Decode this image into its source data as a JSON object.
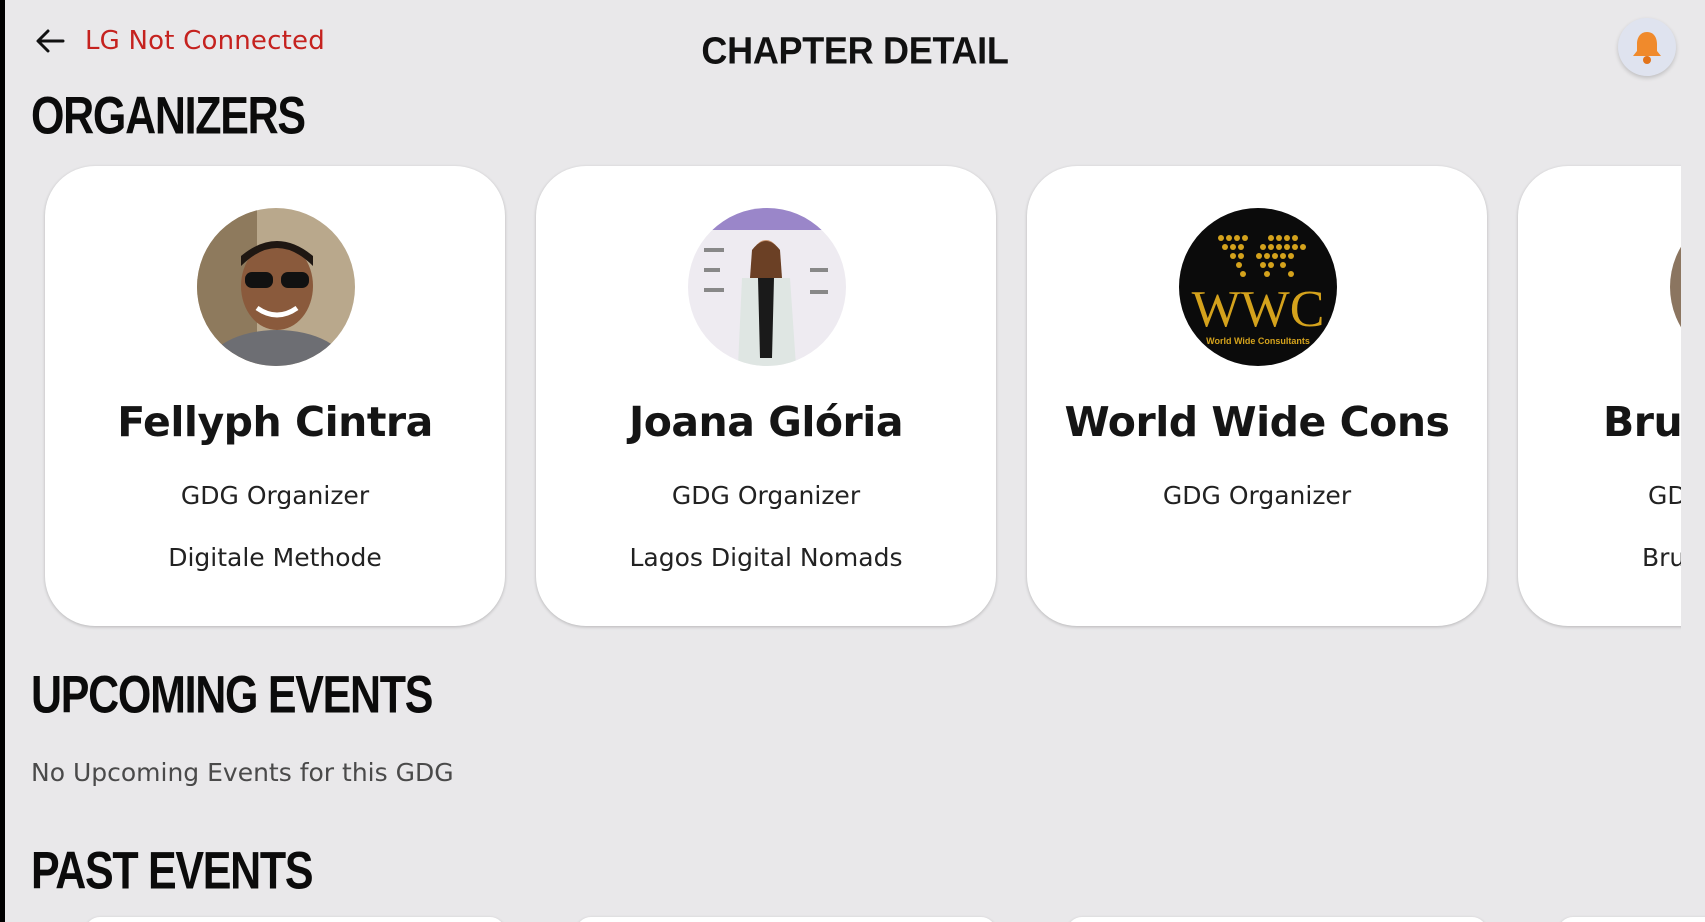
{
  "header": {
    "connection_status": "LG Not Connected",
    "title": "CHAPTER DETAIL",
    "status_color": "#c5221f",
    "back_icon": "arrow-left-icon",
    "notification_icon": "bell-icon"
  },
  "organizers": {
    "heading": "ORGANIZERS",
    "items": [
      {
        "name": "Fellyph Cintra",
        "role": "GDG Organizer",
        "company": "Digitale Methode",
        "avatar": "person-photo"
      },
      {
        "name": "Joana Glória",
        "role": "GDG Organizer",
        "company": "Lagos Digital Nomads",
        "avatar": "person-photo"
      },
      {
        "name": "World Wide Cons",
        "role": "GDG Organizer",
        "company": "",
        "avatar": "wwc-logo",
        "logo_text": "WWC",
        "logo_subtext": "World Wide Consultants"
      },
      {
        "name": "Bru",
        "role": "GD",
        "company": "Bru",
        "avatar": "person-photo"
      }
    ]
  },
  "upcoming_events": {
    "heading": "UPCOMING EVENTS",
    "empty_message": "No Upcoming Events for this GDG"
  },
  "past_events": {
    "heading": "PAST EVENTS"
  }
}
